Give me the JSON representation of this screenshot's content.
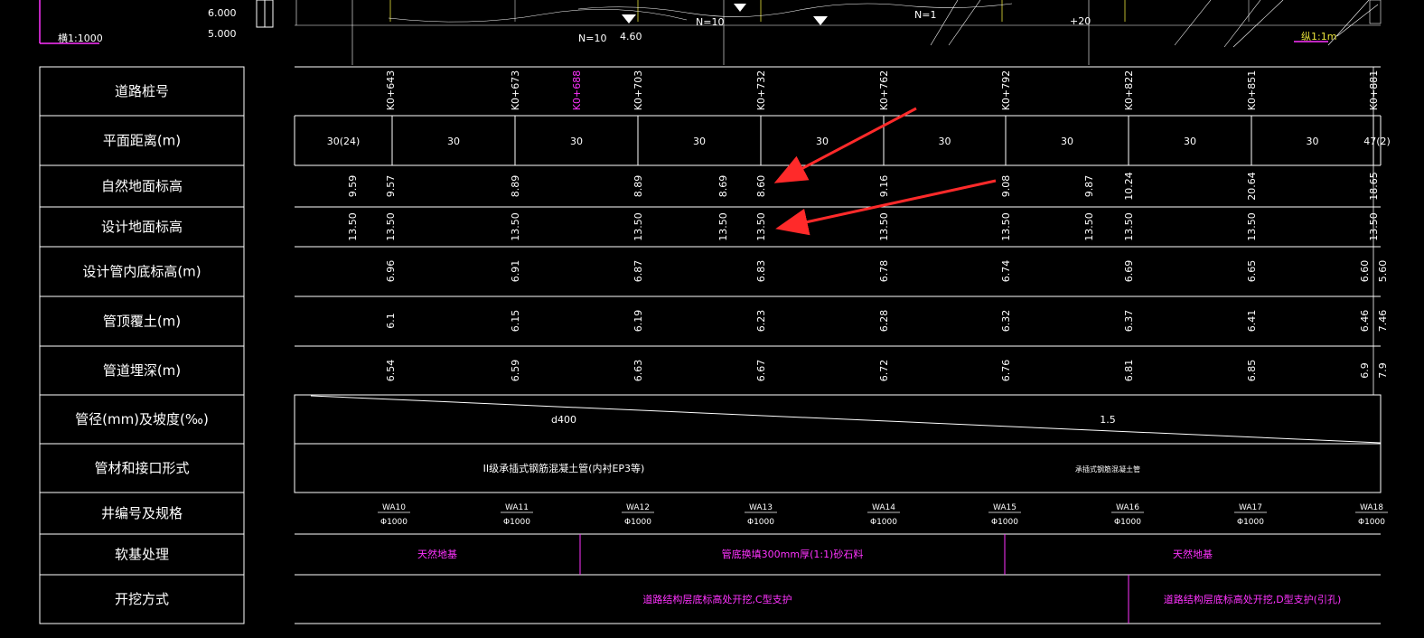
{
  "header": {
    "scale_top": "6.000",
    "scale_bottom": "5.000",
    "ratio": "横1:1000",
    "corner_tag": "纵1:1m"
  },
  "row_labels": [
    "道路桩号",
    "平面距离(m)",
    "自然地面标高",
    "设计地面标高",
    "设计管内底标高(m)",
    "管顶覆土(m)",
    "管道埋深(m)",
    "管径(mm)及坡度(‰)",
    "管材和接口形式",
    "井编号及规格",
    "软基处理",
    "开挖方式"
  ],
  "stations": [
    {
      "label": "K0+643",
      "highlight": false
    },
    {
      "label": "K0+673",
      "highlight": false
    },
    {
      "label": "K0+688",
      "highlight": true
    },
    {
      "label": "K0+703",
      "highlight": false
    },
    {
      "label": "K0+732",
      "highlight": false
    },
    {
      "label": "K0+762",
      "highlight": false
    },
    {
      "label": "K0+792",
      "highlight": false
    },
    {
      "label": "K0+822",
      "highlight": false
    },
    {
      "label": "K0+851",
      "highlight": false
    },
    {
      "label": "K0+881",
      "highlight": false
    }
  ],
  "distances": [
    "30(24)",
    "30",
    "30",
    "30",
    "30",
    "30",
    "30",
    "30",
    "30",
    "47(2)"
  ],
  "natural_ground": [
    "9.59",
    "9.57",
    "8.89",
    "8.89",
    "8.69",
    "8.60",
    "9.16",
    "9.08",
    "9.87",
    "10.24",
    "20.64",
    "18.65"
  ],
  "design_ground": [
    "13.50",
    "13.50",
    "13.50",
    "13.50",
    "13.50",
    "13.50",
    "13.50",
    "13.50",
    "13.50",
    "13.50",
    "13.50",
    "13.50"
  ],
  "invert_elev": [
    "6.96",
    "6.91",
    "6.87",
    "6.83",
    "6.78",
    "6.74",
    "6.69",
    "6.65",
    "6.60",
    "5.60"
  ],
  "cover": [
    "6.1",
    "6.15",
    "6.19",
    "6.23",
    "6.28",
    "6.32",
    "6.37",
    "6.41",
    "6.46",
    "7.46"
  ],
  "depth": [
    "6.54",
    "6.59",
    "6.63",
    "6.67",
    "6.72",
    "6.76",
    "6.81",
    "6.85",
    "6.9",
    "7.9"
  ],
  "pipe": {
    "diameter": "d400",
    "slope": "1.5"
  },
  "material": {
    "left": "II级承插式钢筋混凝土管(内衬EP3等)",
    "right": "承插式钢筋混凝土管"
  },
  "wells": [
    {
      "id": "WA10",
      "spec": "Φ1000"
    },
    {
      "id": "WA11",
      "spec": "Φ1000"
    },
    {
      "id": "WA12",
      "spec": "Φ1000"
    },
    {
      "id": "WA13",
      "spec": "Φ1000"
    },
    {
      "id": "WA14",
      "spec": "Φ1000"
    },
    {
      "id": "WA15",
      "spec": "Φ1000"
    },
    {
      "id": "WA16",
      "spec": "Φ1000"
    },
    {
      "id": "WA17",
      "spec": "Φ1000"
    },
    {
      "id": "WA18",
      "spec": "Φ1000"
    }
  ],
  "soft_base": [
    "天然地基",
    "管底换填300mm厚(1:1)砂石料",
    "天然地基"
  ],
  "excavation": [
    "道路结构层底标高处开挖,C型支护",
    "道路结构层底标高处开挖,D型支护(引孔)"
  ],
  "profile_text": {
    "n_left": "N=10",
    "v_left": "4.60",
    "n_mid": "N=10",
    "n_right": "N=1",
    "plus_right": "+20"
  },
  "colors": {
    "background": "#000000",
    "line": "#ffffff",
    "magenta": "#ff33ff",
    "arrow": "#ff2a2a",
    "yellow": "#e8e23a"
  }
}
